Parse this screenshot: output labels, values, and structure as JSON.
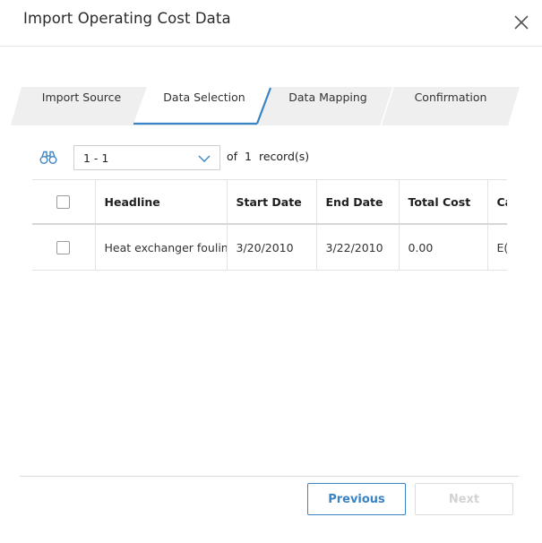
{
  "dialog": {
    "title": "Import Operating Cost Data"
  },
  "stepper": {
    "steps": [
      {
        "label": "Import Source",
        "active": false
      },
      {
        "label": "Data Selection",
        "active": true
      },
      {
        "label": "Data Mapping",
        "active": false
      },
      {
        "label": "Confirmation",
        "active": false
      }
    ],
    "active_color": "#3b84c4"
  },
  "toolbar": {
    "find_icon": "binoculars-icon",
    "range_value": "1 - 1",
    "record_of": "of",
    "record_total": "1",
    "record_unit": "record(s)"
  },
  "grid": {
    "columns": [
      "Headline",
      "Start Date",
      "End Date",
      "Total Cost",
      "Ca"
    ],
    "rows": [
      [
        "Heat exchanger fouling",
        "3/20/2010",
        "3/22/2010",
        "0.00",
        "E("
      ]
    ]
  },
  "footer": {
    "previous_label": "Previous",
    "next_label": "Next"
  }
}
